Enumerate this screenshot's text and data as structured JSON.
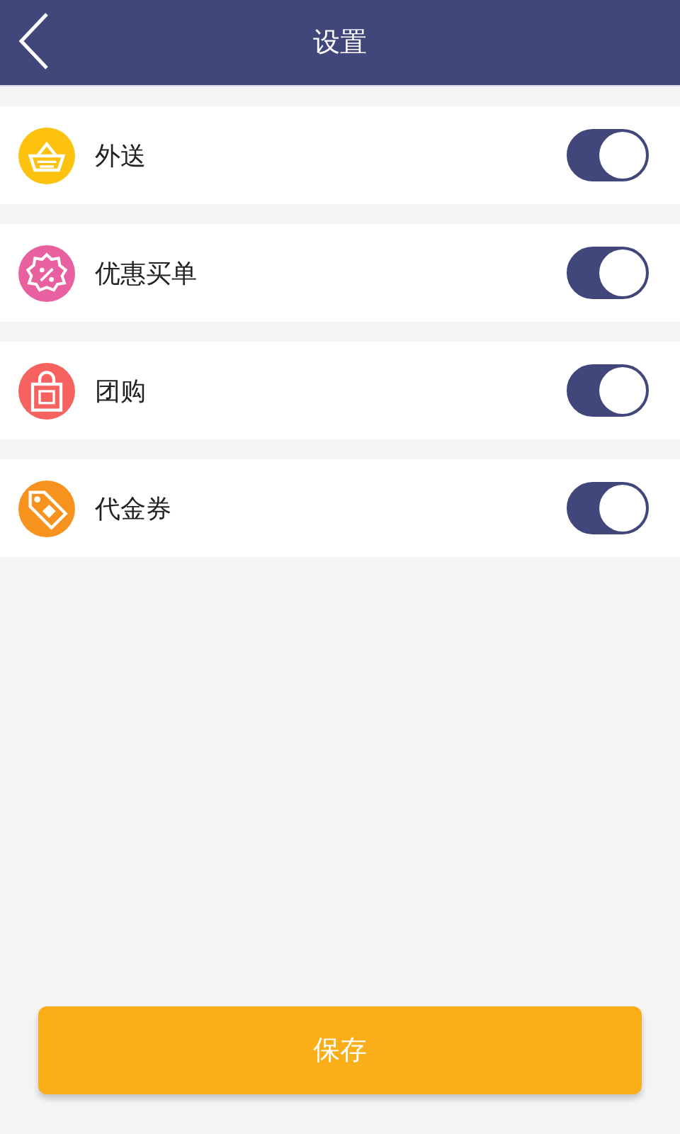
{
  "header": {
    "title": "设置"
  },
  "settings": [
    {
      "label": "外送",
      "color": "#fdc10f",
      "on": true
    },
    {
      "label": "优惠买单",
      "color": "#e8609f",
      "on": true
    },
    {
      "label": "团购",
      "color": "#f5625f",
      "on": true
    },
    {
      "label": "代金券",
      "color": "#f7921e",
      "on": true
    }
  ],
  "save_button": "保存"
}
